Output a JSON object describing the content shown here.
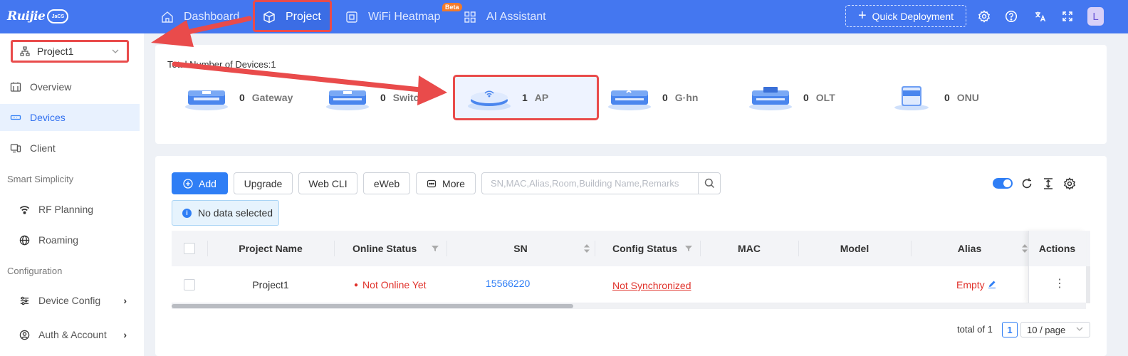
{
  "brand": {
    "name": "Ruijie",
    "cloud_label": "JaCS"
  },
  "nav": {
    "dashboard": "Dashboard",
    "project": "Project",
    "heatmap": "WiFi Heatmap",
    "heatmap_badge": "Beta",
    "ai": "AI Assistant"
  },
  "header": {
    "quick_deploy": "Quick Deployment",
    "avatar": "L"
  },
  "sidebar": {
    "project_selector": "Project1",
    "items": {
      "overview": "Overview",
      "devices": "Devices",
      "client": "Client",
      "rf_planning": "RF Planning",
      "roaming": "Roaming",
      "device_config": "Device Config",
      "auth_account": "Auth & Account"
    },
    "groups": {
      "smart": "Smart Simplicity",
      "configuration": "Configuration"
    }
  },
  "summary": {
    "total_label": "Total Number of Devices:1",
    "devices": [
      {
        "count": "0",
        "name": "Gateway"
      },
      {
        "count": "0",
        "name": "Switch"
      },
      {
        "count": "1",
        "name": "AP"
      },
      {
        "count": "0",
        "name": "G·hn"
      },
      {
        "count": "0",
        "name": "OLT"
      },
      {
        "count": "0",
        "name": "ONU"
      }
    ]
  },
  "toolbar": {
    "add": "Add",
    "upgrade": "Upgrade",
    "webcli": "Web CLI",
    "eweb": "eWeb",
    "more": "More",
    "search_placeholder": "SN,MAC,Alias,Room,Building Name,Remarks",
    "selection_info": "No data selected"
  },
  "table": {
    "columns": [
      "Project Name",
      "Online Status",
      "SN",
      "Config Status",
      "MAC",
      "Model",
      "Alias",
      "Actions"
    ],
    "rows": [
      {
        "project": "Project1",
        "status": "Not Online Yet",
        "sn": "15566220",
        "config": "Not Synchronized",
        "mac": "",
        "model": "",
        "alias": "Empty"
      }
    ]
  },
  "pagination": {
    "total": "total of 1",
    "page": "1",
    "page_size": "10 / page"
  },
  "colors": {
    "primary": "#4477f0",
    "accent": "#2f7ef5",
    "annotation": "#e94b4b",
    "error": "#e0322b"
  }
}
